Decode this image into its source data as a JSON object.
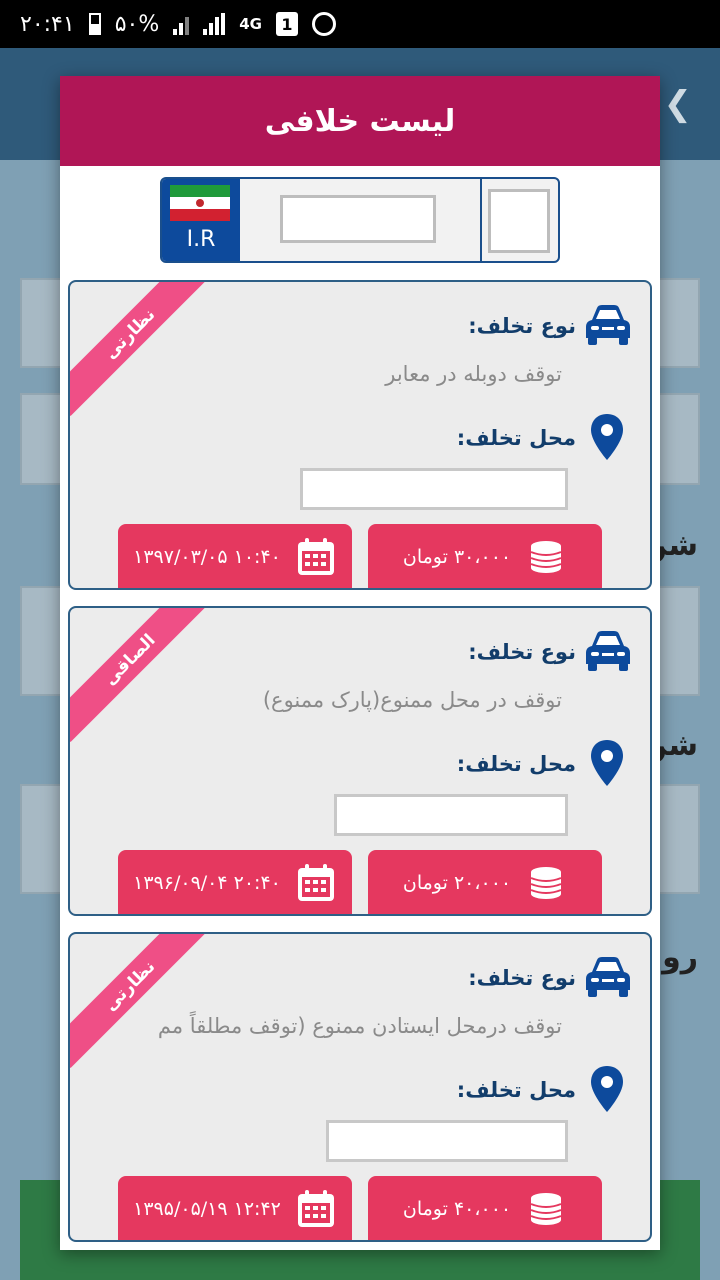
{
  "status_bar": {
    "time": "۲۰:۴۱",
    "battery": "۵۰%",
    "network": "4G",
    "sim": "1"
  },
  "dialog": {
    "title": "لیست خلافی"
  },
  "plate": {
    "country": "I.R"
  },
  "labels": {
    "violation_type": "نوع تخلف:",
    "violation_location": "محل تخلف:"
  },
  "violations": [
    {
      "ribbon": "نظارتی",
      "type": "توقف دوبله در معابر",
      "amount": "۳۰،۰۰۰ تومان",
      "datetime": "۱۰:۴۰ ۱۳۹۷/۰۳/۰۵"
    },
    {
      "ribbon": "الصاقی",
      "type": "توقف در محل ممنوع(پارک ممنوع)",
      "amount": "۲۰،۰۰۰ تومان",
      "datetime": "۲۰:۴۰ ۱۳۹۶/۰۹/۰۴"
    },
    {
      "ribbon": "نظارتی",
      "type": "توقف درمحل ایستادن ممنوع (توقف مطلقاً مم",
      "amount": "۴۰،۰۰۰ تومان",
      "datetime": "۱۲:۴۲ ۱۳۹۵/۰۵/۱۹"
    }
  ],
  "background": {
    "label_1": "شن",
    "label_2": "شن",
    "label_3": "روش"
  },
  "icons": {
    "violation_type": "car-icon",
    "location": "map-pin-icon",
    "amount": "coins-icon",
    "date": "calendar-icon"
  },
  "colors": {
    "header": "#b01656",
    "button": "#e5385f",
    "ribbon": "#ef4f86",
    "icon_blue": "#0d4a9c"
  }
}
